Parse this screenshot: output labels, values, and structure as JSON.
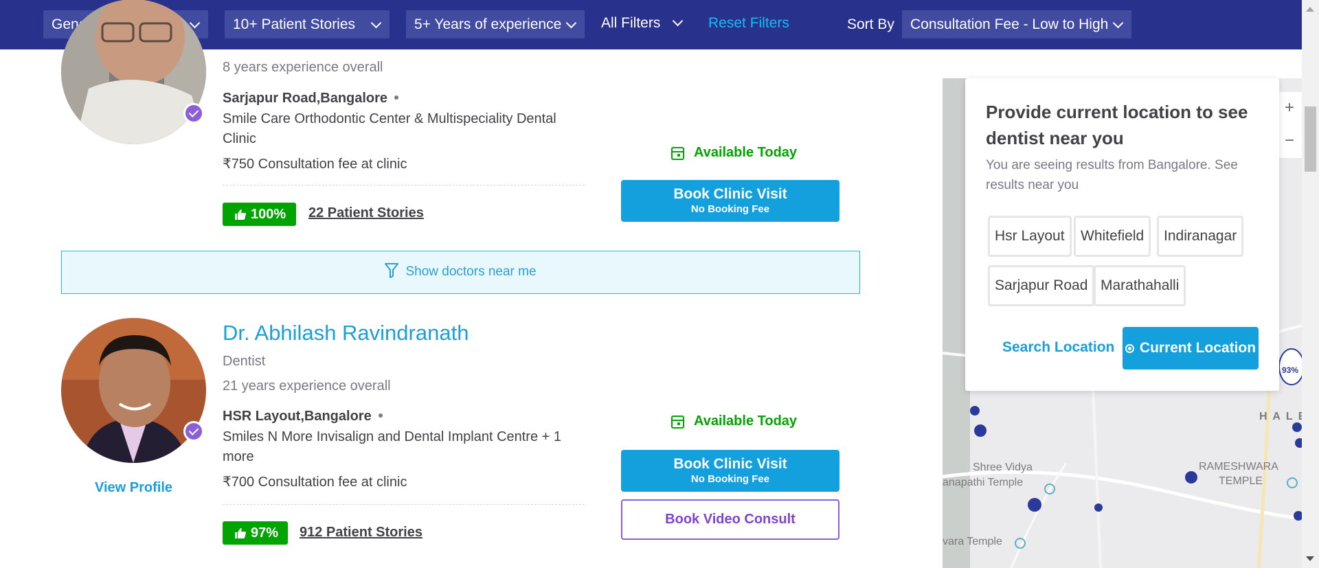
{
  "filters": {
    "gender": "Gender",
    "patient_stories": "10+ Patient Stories",
    "experience": "5+ Years of experience",
    "all_filters": "All Filters",
    "reset": "Reset Filters",
    "sort_label": "Sort By",
    "sort_value": "Consultation Fee - Low to High"
  },
  "doctor1": {
    "experience": "8 years experience overall",
    "location": "Sarjapur Road,Bangalore",
    "clinic": "Smile Care Orthodontic Center & Multispeciality Dental Clinic",
    "fee": "₹750 Consultation fee at clinic",
    "rating": "100%",
    "stories": "22 Patient Stories",
    "availability": "Available Today",
    "book_label": "Book Clinic Visit",
    "book_sub": "No Booking Fee"
  },
  "show_near": "Show doctors near me",
  "doctor2": {
    "name": "Dr. Abhilash Ravindranath",
    "specialty": "Dentist",
    "experience": "21 years experience overall",
    "location": "HSR Layout,Bangalore",
    "clinic": "Smiles N More Invisalign and Dental Implant Centre + 1 more",
    "fee": "₹700 Consultation fee at clinic",
    "rating": "97%",
    "stories": "912 Patient Stories",
    "view_profile": "View Profile",
    "availability": "Available Today",
    "book_label": "Book Clinic Visit",
    "book_sub": "No Booking Fee",
    "video_label": "Book Video Consult"
  },
  "location_popup": {
    "title": "Provide current location to see dentist near you",
    "subtitle": "You are seeing results from Bangalore. See results near you",
    "chips": [
      "Hsr Layout",
      "Whitefield",
      "Indiranagar",
      "Sarjapur Road",
      "Marathahalli"
    ],
    "search": "Search Location",
    "current": "Current Location"
  },
  "map": {
    "zoom_in": "+",
    "zoom_out": "−",
    "labels": {
      "hale": "H A L E",
      "shree_vidya": "Shree Vidya",
      "ganapathi": "anapathi Temple",
      "rameshwara1": "RAMESHWARA",
      "rameshwara2": "TEMPLE",
      "vara_temple": "vara Temple",
      "rating_pin": "93%"
    }
  },
  "colors": {
    "header_bg": "#28328c",
    "accent_blue": "#14a0dc",
    "success_green": "#01a400",
    "purple": "#8a5fd8"
  }
}
